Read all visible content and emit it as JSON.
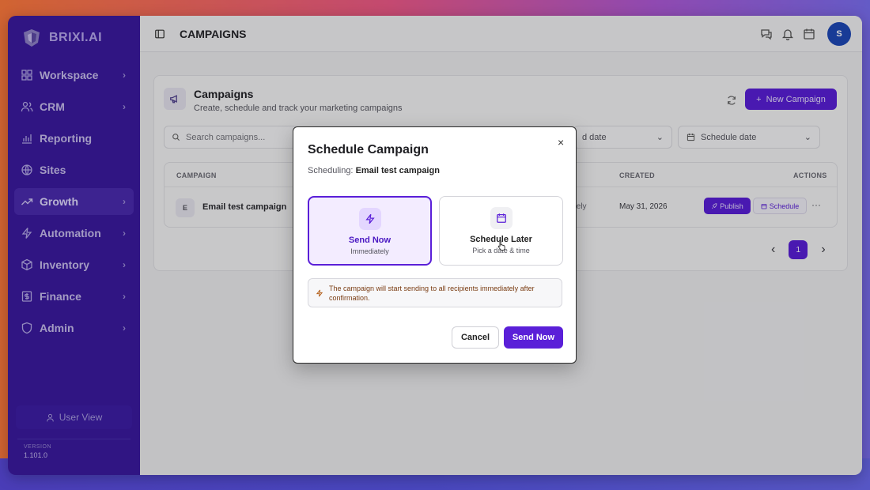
{
  "brand": {
    "name": "BRIXI.AI"
  },
  "sidebar": {
    "items": [
      {
        "label": "Workspace",
        "icon": "grid-icon",
        "chevron": "›"
      },
      {
        "label": "CRM",
        "icon": "users-icon",
        "chevron": "›"
      },
      {
        "label": "Reporting",
        "icon": "bar-chart-icon",
        "chevron": ""
      },
      {
        "label": "Sites",
        "icon": "globe-icon",
        "chevron": ""
      },
      {
        "label": "Growth",
        "icon": "trending-up-icon",
        "chevron": "›",
        "active": true
      },
      {
        "label": "Automation",
        "icon": "bolt-icon",
        "chevron": "›"
      },
      {
        "label": "Inventory",
        "icon": "box-icon",
        "chevron": "›"
      },
      {
        "label": "Finance",
        "icon": "dollar-icon",
        "chevron": "›"
      },
      {
        "label": "Admin",
        "icon": "shield-icon",
        "chevron": "›"
      }
    ],
    "user_view_label": "User View",
    "version_label": "VERSION",
    "version_value": "1.101.0"
  },
  "topbar": {
    "title": "CAMPAIGNS",
    "avatar_initial": "S"
  },
  "campaigns": {
    "title": "Campaigns",
    "subtitle": "Create, schedule and track your marketing campaigns",
    "new_button": "New Campaign",
    "search_placeholder": "Search campaigns...",
    "filter_created_date": "d date",
    "filter_schedule_date": "Schedule date",
    "table": {
      "headers": {
        "campaign": "CAMPAIGN",
        "created": "CREATED",
        "actions": "ACTIONS"
      },
      "rows": [
        {
          "badge": "E",
          "name": "Email test campaign",
          "schedule": "tely",
          "created": "May 31, 2026",
          "publish": "Publish",
          "schedule_btn": "Schedule",
          "more": "···"
        }
      ]
    },
    "pagination": {
      "prev": "‹",
      "current": "1",
      "next": "›"
    }
  },
  "modal": {
    "title": "Schedule Campaign",
    "scheduling_label": "Scheduling:",
    "campaign_name": "Email test campaign",
    "close": "×",
    "options": [
      {
        "title": "Send Now",
        "subtitle": "Immediately",
        "icon": "bolt-icon",
        "selected": true
      },
      {
        "title": "Schedule Later",
        "subtitle": "Pick a date & time",
        "icon": "calendar-icon",
        "selected": false
      }
    ],
    "notice": "The campaign will start sending to all recipients immediately after confirmation.",
    "cancel": "Cancel",
    "confirm": "Send Now"
  },
  "colors": {
    "accent": "#5a1fd8",
    "sidebar": "#3b1aa0",
    "avatar": "#1e48b8"
  }
}
